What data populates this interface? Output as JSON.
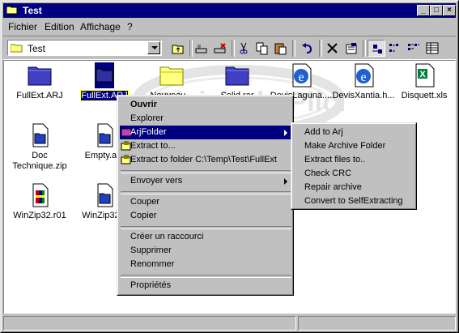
{
  "window": {
    "title": "Test",
    "minimize_label": "_",
    "maximize_label": "□",
    "close_label": "×"
  },
  "menubar": [
    {
      "label": "Fichier"
    },
    {
      "label": "Edition"
    },
    {
      "label": "Affichage"
    },
    {
      "label": "?"
    }
  ],
  "address": {
    "value": "Test"
  },
  "toolbar_icons": [
    "up-folder-icon",
    "map-drive-icon",
    "disconnect-drive-icon",
    "cut-icon",
    "copy-icon",
    "paste-icon",
    "undo-icon",
    "delete-icon",
    "properties-icon",
    "large-icons-view-icon",
    "small-icons-view-icon",
    "list-view-icon",
    "details-view-icon"
  ],
  "watermark_text": "Plaisir du Plica",
  "files": [
    {
      "name": "FullExt.ARJ",
      "icon": "folder-icon",
      "selected": false
    },
    {
      "name": "FullExt.ARJ",
      "icon": "folder-icon",
      "selected": true
    },
    {
      "name": "Nouveau...",
      "icon": "folder-icon",
      "selected": false
    },
    {
      "name": "Solid.rar",
      "icon": "folder-icon",
      "selected": false
    },
    {
      "name": "DevisLaguna....",
      "icon": "html-document-icon",
      "selected": false
    },
    {
      "name": "DevisXantia.h...",
      "icon": "html-document-icon",
      "selected": false
    },
    {
      "name": "Disquett.xls",
      "icon": "excel-document-icon",
      "selected": false
    },
    {
      "name": "Doc Technique.zip",
      "icon": "zip-file-icon",
      "selected": false
    },
    {
      "name": "Empty.a...",
      "icon": "zip-file-icon",
      "selected": false
    },
    {
      "name": "WinZip32.r01",
      "icon": "winzip-icon",
      "selected": false
    },
    {
      "name": "WinZip32...",
      "icon": "zip-file-icon",
      "selected": false
    }
  ],
  "context_menu": [
    {
      "label": "Ouvrir",
      "bold": true
    },
    {
      "label": "Explorer"
    },
    {
      "label": "ArjFolder",
      "submenu": true,
      "highlighted": true
    },
    {
      "label": "Extract to..."
    },
    {
      "label": "Extract to folder C:\\Temp\\Test\\FullExt"
    },
    {
      "label": "Envoyer vers",
      "submenu": true
    },
    {
      "label": "Couper"
    },
    {
      "label": "Copier"
    },
    {
      "label": "Créer un raccourci"
    },
    {
      "label": "Supprimer"
    },
    {
      "label": "Renommer"
    },
    {
      "label": "Propriétés"
    }
  ],
  "submenu": [
    {
      "label": "Add to Arj"
    },
    {
      "label": "Make Archive Folder"
    },
    {
      "label": "Extract files to.."
    },
    {
      "label": "Check CRC"
    },
    {
      "label": "Repair archive"
    },
    {
      "label": "Convert to SelfExtracting"
    }
  ],
  "colors": {
    "selection": "#000080",
    "face": "#c0c0c0",
    "titlebar": "#000080"
  }
}
